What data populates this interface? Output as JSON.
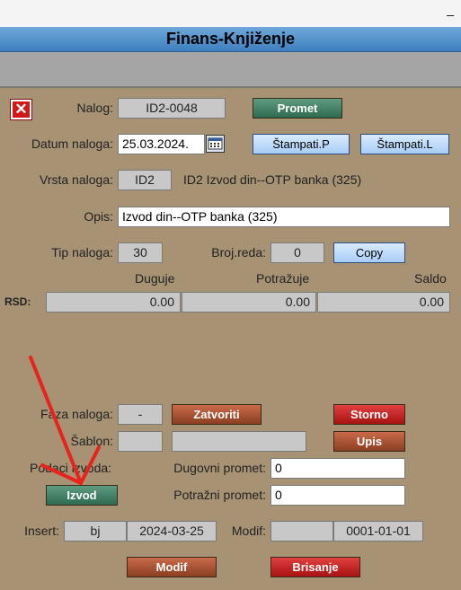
{
  "window": {
    "minimize_glyph": "_",
    "title": "Finans-Knjiženje"
  },
  "form": {
    "close_icon": "close-icon",
    "nalog_label": "Nalog:",
    "nalog_value": "ID2-0048",
    "promet_button": "Promet",
    "datum_label": "Datum naloga:",
    "datum_value": "25.03.2024.",
    "calendar_icon": "calendar-icon",
    "stampati_p": "Štampati.P",
    "stampati_l": "Štampati.L",
    "vrsta_label": "Vrsta naloga:",
    "vrsta_value": "ID2",
    "vrsta_desc": "ID2 Izvod din--OTP banka (325)",
    "opis_label": "Opis:",
    "opis_value": "Izvod din--OTP banka (325)",
    "tip_label": "Tip naloga:",
    "tip_value": "30",
    "broj_label": "Broj.reda:",
    "broj_value": "0",
    "copy_button": "Copy"
  },
  "totals": {
    "currency": "RSD:",
    "headers": [
      "Duguje",
      "Potražuje",
      "Saldo"
    ],
    "values": [
      "0.00",
      "0.00",
      "0.00"
    ]
  },
  "bottom": {
    "faza_label": "Faza naloga:",
    "faza_value": "-",
    "zatvoriti_button": "Zatvoriti",
    "storno_button": "Storno",
    "sablon_label": "Šablon:",
    "sablon_code": "",
    "sablon_name": "",
    "upis_button": "Upis",
    "podaci_label": "Podaci izvoda:",
    "izvod_button": "Izvod",
    "dugovni_label": "Dugovni promet:",
    "dugovni_value": "0",
    "potrazni_label": "Potražni promet:",
    "potrazni_value": "0",
    "insert_label": "Insert:",
    "insert_user": "bj",
    "insert_date": "2024-03-25",
    "modif_label": "Modif:",
    "modif_user": "",
    "modif_date": "0001-01-01",
    "modif_button": "Modif",
    "brisanje_button": "Brisanje"
  },
  "annotation": {
    "arrow_color": "#e8231c"
  }
}
